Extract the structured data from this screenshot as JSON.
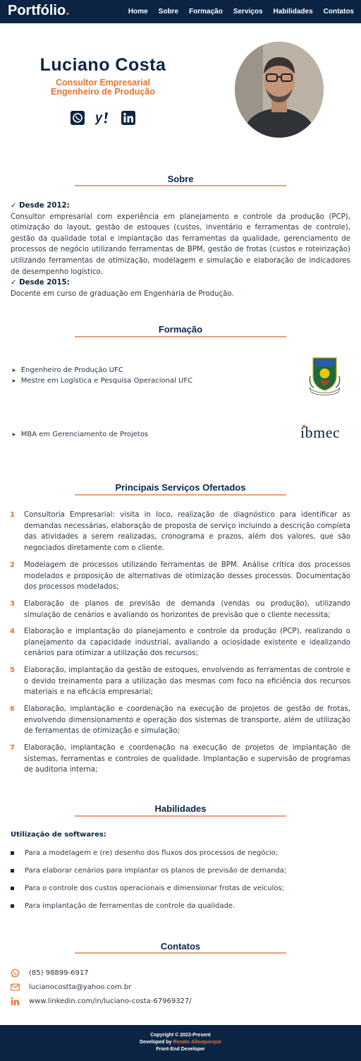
{
  "header": {
    "logo": "Portfólio",
    "logo_dot": ".",
    "nav": [
      "Home",
      "Sobre",
      "Formação",
      "Serviços",
      "Habilidades",
      "Contatos"
    ]
  },
  "hero": {
    "name": "Luciano Costa",
    "role_line1": "Consultor Empresarial",
    "role_line2": "Engenheiro de Produção",
    "social_icons": [
      "whatsapp-icon",
      "yahoo-icon",
      "linkedin-icon"
    ]
  },
  "sobre": {
    "title": "Sobre",
    "h1": "✓ Desde 2012:",
    "p1": "Consultor empresarial com experiência em planejamento e controle da produção (PCP), otimização do layout, gestão de estoques (custos, inventário e ferramentas de controle), gestão da qualidade total e implantação das ferramentas da qualidade, gerenciamento de processos de negócio utilizando ferramentas de BPM, gestão de frotas (custos e roteirização) utilizando ferramentas de otimização, modelagem e simulação e elaboração de indicadores de desempenho logístico.",
    "h2": "✓ Desde 2015:",
    "p2": "Docente em curso de graduação em Engenharia de Produção."
  },
  "formacao": {
    "title": "Formação",
    "group1": [
      "Engenheiro de Produção UFC",
      "Mestre em Logística e Pesquisa Operacional UFC"
    ],
    "group2": [
      "MBA em Gerenciamento de Projetos"
    ],
    "ibmec_logo": "ibmec"
  },
  "servicos": {
    "title": "Principais Serviços Ofertados",
    "items": [
      {
        "n": "1",
        "text": "Consultoria Empresarial: visita in loco, realização de diagnóstico para identificar as demandas necessárias, elaboração de proposta de serviço incluindo a descrição completa das atividades a serem realizadas, cronograma e prazos, além dos valores, que são negociados diretamente com o cliente."
      },
      {
        "n": "2",
        "text": "Modelagem de processos utilizando ferramentas de BPM. Análise crítica dos processos modelados e proposição de alternativas de otimização desses processos. Documentação dos processos modelados;"
      },
      {
        "n": "3",
        "text": "Elaboração de planos de previsão de demanda (vendas ou produção), utilizando simulação de cenários e avaliando os horizontes de previsão que o cliente necessita;"
      },
      {
        "n": "4",
        "text": "Elaboração e implantação do planejamento e controle da produção (PCP), realizando o planejamento da capacidade industrial, avaliando a ociosidade existente e idealizando cenários para otimizar a utilização dos recursos;"
      },
      {
        "n": "5",
        "text": "Elaboração, implantação da gestão de estoques, envolvendo as ferramentas de controle e o devido treinamento para a utilização das mesmas com foco na eficiência dos recursos materiais e na eficácia empresarial;"
      },
      {
        "n": "6",
        "text": "Elaboração, implantação e coordenação na execução de projetos de gestão de frotas, envolvendo dimensionamento e operação dos sistemas de transporte, além de utilização de ferramentas de otimização e simulação;"
      },
      {
        "n": "7",
        "text": "Elaboração, implantação e coordenação na execução de projetos de implantação de sistemas, ferramentas e controles de qualidade. Implantação e supervisão de programas de auditoria interna;"
      }
    ]
  },
  "habilidades": {
    "title": "Habilidades",
    "heading": "Utilização de softwares:",
    "items": [
      "Para a modelagem e (re) desenho dos fluxos dos processos de negócio;",
      "Para elaborar cenários para implantar os planos de previsão de demanda;",
      "Para o controle dos custos operacionais e dimensionar frotas de veículos;",
      "Para implantação de ferramentas de controle da qualidade."
    ]
  },
  "contatos": {
    "title": "Contatos",
    "phone": "(85) 98899-6917",
    "email": "lucianocostta@yahoo.com.br",
    "linkedin": "www.linkedin.com/in/luciano-costa-67969327/"
  },
  "footer": {
    "copyright": "Copyright © 2023-Present",
    "dev_prefix": "Developed by ",
    "dev_name": "Renato Albuquerque",
    "dev_role": "Front-End Developer"
  },
  "colors": {
    "navy": "#0b2444",
    "accent": "#e8742e"
  }
}
